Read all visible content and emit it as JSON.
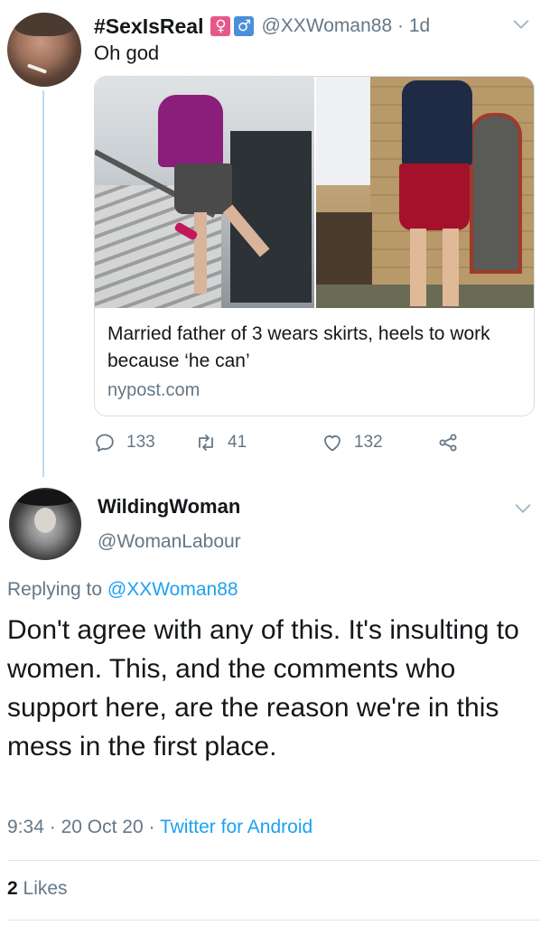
{
  "parent_tweet": {
    "display_name": "#SexIsReal",
    "gender_icons": [
      "♀",
      "♂"
    ],
    "handle": "@XXWoman88",
    "separator": "·",
    "age": "1d",
    "text": "Oh god",
    "card": {
      "title": "Married father of 3 wears skirts, heels to work because ‘he can’",
      "domain": "nypost.com"
    },
    "actions": {
      "replies": "133",
      "retweets": "41",
      "likes": "132"
    }
  },
  "main_tweet": {
    "display_name": "WildingWoman",
    "handle": "@WomanLabour",
    "replying_prefix": "Replying to",
    "replying_to": "@XXWoman88",
    "text": "Don't agree with any of this. It's insulting to women. This, and the comments who support here, are the reason we're in this mess in the first place.",
    "time": "9:34",
    "date": "20 Oct 20",
    "source": "Twitter for Android",
    "dot": "·",
    "likes_count": "2",
    "likes_label": "Likes"
  },
  "colors": {
    "accent": "#1da1f2",
    "secondary_text": "#657786",
    "thread_line": "#b9dcf5"
  },
  "icons": [
    "reply-icon",
    "retweet-icon",
    "like-icon",
    "share-icon",
    "chevron-down-icon"
  ]
}
